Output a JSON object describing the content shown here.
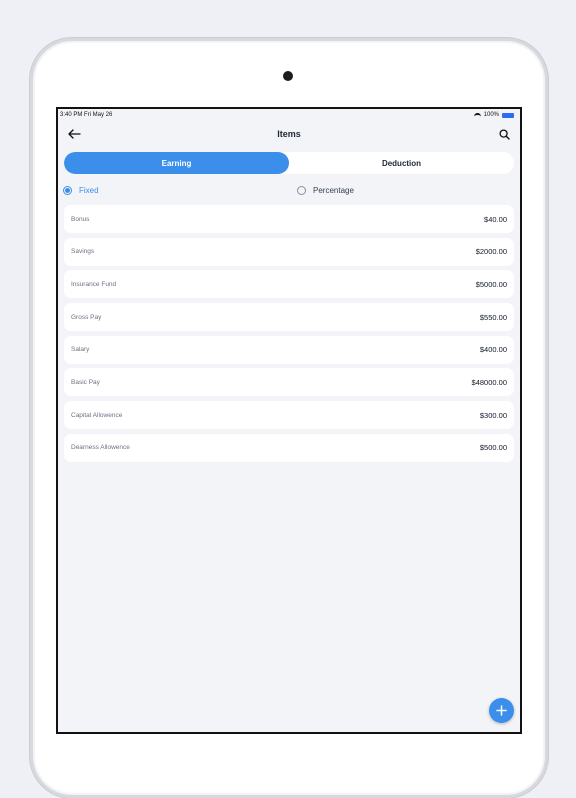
{
  "status": {
    "time_date": "3:40 PM  Fri May 26",
    "battery": "100%"
  },
  "nav": {
    "title": "Items"
  },
  "tabs": [
    {
      "label": "Earning",
      "active": true
    },
    {
      "label": "Deduction",
      "active": false
    }
  ],
  "type_options": [
    {
      "label": "Fixed",
      "selected": true
    },
    {
      "label": "Percentage",
      "selected": false
    }
  ],
  "items": [
    {
      "label": "Bonus",
      "value": "$40.00"
    },
    {
      "label": "Savings",
      "value": "$2000.00"
    },
    {
      "label": "Insurance Fund",
      "value": "$5000.00"
    },
    {
      "label": "Gross Pay",
      "value": "$550.00"
    },
    {
      "label": "Salary",
      "value": "$400.00"
    },
    {
      "label": "Basic Pay",
      "value": "$48000.00"
    },
    {
      "label": "Capital Allowence",
      "value": "$300.00"
    },
    {
      "label": "Dearness Allowence",
      "value": "$500.00"
    }
  ],
  "colors": {
    "accent": "#3b8eea",
    "background": "#f2f4f8"
  },
  "icons": {
    "back": "arrow-left-icon",
    "search": "search-icon",
    "add": "plus-icon"
  }
}
